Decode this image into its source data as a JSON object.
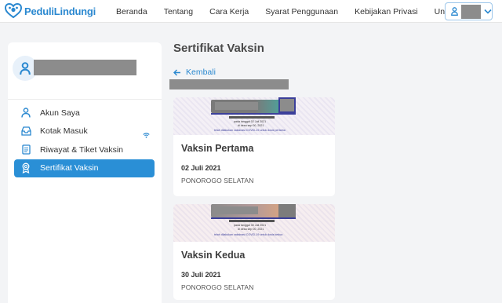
{
  "brand": {
    "name": "PeduliLindungi",
    "color": "#2a88d0"
  },
  "nav": {
    "items": [
      "Beranda",
      "Tentang",
      "Cara Kerja",
      "Syarat Penggunaan",
      "Kebijakan Privasi",
      "Unduh"
    ]
  },
  "user_menu": {
    "icon": "user-icon",
    "dropdown_icon": "chevron-down-icon"
  },
  "sidebar": {
    "items": [
      {
        "label": "Akun Saya",
        "icon": "user-icon"
      },
      {
        "label": "Kotak Masuk",
        "icon": "inbox-icon"
      },
      {
        "label": "Riwayat & Tiket Vaksin",
        "icon": "document-icon"
      },
      {
        "label": "Sertifikat Vaksin",
        "icon": "certificate-icon",
        "active": true
      }
    ]
  },
  "main": {
    "title": "Sertifikat Vaksin",
    "back_label": "Kembali",
    "cards": [
      {
        "title": "Vaksin Pertama",
        "date": "02 Juli 2021",
        "location": "PONOROGO SELATAN",
        "cert_line1": "pada tanggal 02 Juli 2021",
        "cert_line2": "di desa sep 00, 2021",
        "cert_line3": "telah dilakukan vaksinasi COVID-19 untuk dosis pertama"
      },
      {
        "title": "Vaksin Kedua",
        "date": "30 Juli 2021",
        "location": "PONOROGO SELATAN",
        "cert_line1": "pada tanggal 30 Juli 2021",
        "cert_line2": "di desa sep 00, 2021",
        "cert_line3": "telah dilakukan vaksinasi COVID-19 untuk dosis kedua"
      }
    ]
  },
  "colors": {
    "accent": "#2a8fd6",
    "background": "#f3f4f6"
  }
}
